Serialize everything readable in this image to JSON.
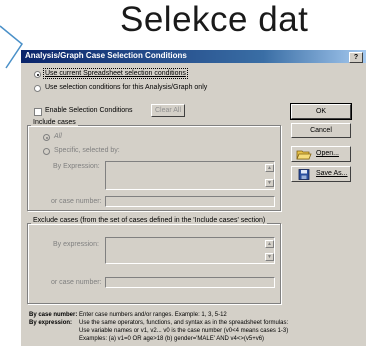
{
  "slide": {
    "heading": "Selekce dat"
  },
  "dialog": {
    "title": "Analysis/Graph Case Selection Conditions",
    "help_label": "?",
    "source_options": [
      "Use current Spreadsheet selection conditions",
      "Use selection conditions for this Analysis/Graph only"
    ],
    "enable_label": "Enable Selection Conditions",
    "clear_all_label": "Clear All",
    "include": {
      "title": "Include cases",
      "all_label": "All",
      "specific_label": "Specific, selected by:",
      "by_expression_label": "By Expression:",
      "case_number_label": "or case number:"
    },
    "exclude": {
      "title": "Exclude cases (from the set of cases defined in the 'Include cases' section)",
      "by_expression_label": "By expression:",
      "case_number_label": "or case number:"
    },
    "buttons": {
      "ok": "OK",
      "cancel": "Cancel",
      "open": "Open...",
      "save_as": "Save As..."
    },
    "help": {
      "case_number_term": "By case number:",
      "case_number_text": "Enter case numbers and/or ranges.  Example:  1, 3, 5-12",
      "expression_term": "By expression:",
      "expression_line1": "Use the same operators, functions, and syntax as in the spreadsheet formulas:",
      "expression_line2": "Use variable names or v1, v2...    v0 is the case number  (v0<4 means cases 1-3)",
      "expression_line3": "Examples:  (a) v1=0 OR age>18   (b) gender='MALE' AND v4<>(v5+v6)"
    }
  },
  "colors": {
    "title_bar": "#0a246a",
    "dialog_bg": "#d4d0c8",
    "arrow_stroke": "#4a90c8"
  },
  "icons": [
    "arrow-callout-icon",
    "open-folder-icon",
    "save-disk-icon",
    "scroll-up-icon",
    "scroll-down-icon"
  ]
}
